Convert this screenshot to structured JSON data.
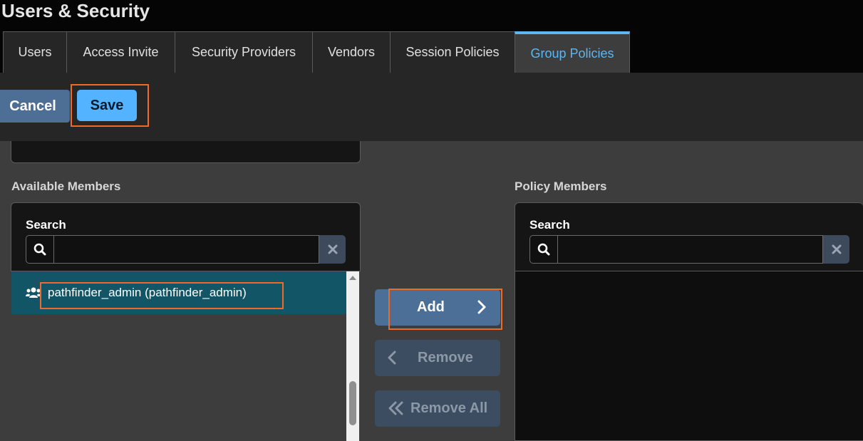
{
  "header": {
    "title": "Users & Security"
  },
  "tabs": [
    {
      "label": "Users",
      "active": false
    },
    {
      "label": "Access Invite",
      "active": false
    },
    {
      "label": "Security Providers",
      "active": false
    },
    {
      "label": "Vendors",
      "active": false
    },
    {
      "label": "Session Policies",
      "active": false
    },
    {
      "label": "Group Policies",
      "active": true
    }
  ],
  "toolbar": {
    "cancel_label": "Cancel",
    "save_label": "Save"
  },
  "available": {
    "title": "Available Members",
    "search_label": "Search",
    "search_value": "",
    "items": [
      {
        "label": "pathfinder_admin (pathfinder_admin)",
        "icon": "users-icon",
        "selected": true
      }
    ]
  },
  "actions": {
    "add_label": "Add",
    "remove_label": "Remove",
    "remove_all_label": "Remove All"
  },
  "policy": {
    "title": "Policy Members",
    "search_label": "Search",
    "search_value": ""
  },
  "colors": {
    "accent": "#5cb6f2",
    "primary_button": "#54b3ff",
    "secondary_button": "#4d6f96",
    "selected_row": "#115566",
    "highlight": "#ee6a25"
  }
}
